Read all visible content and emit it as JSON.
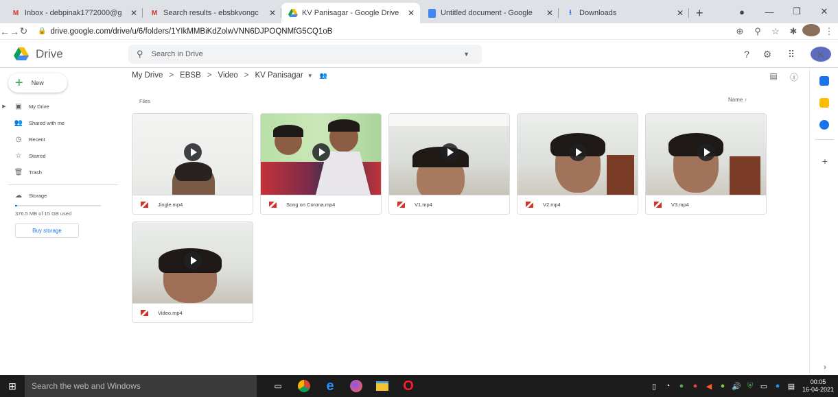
{
  "browser": {
    "tabs": [
      {
        "title": "Inbox - debpinak1772000@g",
        "icon": "gmail-icon",
        "active": false
      },
      {
        "title": "Search results - ebsbkvongc",
        "icon": "gmail-icon",
        "active": false
      },
      {
        "title": "KV Panisagar - Google Drive",
        "icon": "drive-icon",
        "active": true
      },
      {
        "title": "Untitled document - Google",
        "icon": "docs-icon",
        "active": false
      },
      {
        "title": "Downloads",
        "icon": "download-icon",
        "active": false
      }
    ],
    "url": "drive.google.com/drive/u/6/folders/1YIkMMBiKdZolwVNN6DJPOQNMfG5CQ1oB"
  },
  "drive": {
    "brand": "Drive",
    "search_placeholder": "Search in Drive",
    "account_initial": "K",
    "new_label": "New",
    "nav": [
      {
        "label": "My Drive",
        "icon": "my-drive-icon"
      },
      {
        "label": "Shared with me",
        "icon": "shared-icon"
      },
      {
        "label": "Recent",
        "icon": "clock-icon"
      },
      {
        "label": "Starred",
        "icon": "star-icon"
      },
      {
        "label": "Trash",
        "icon": "trash-icon"
      }
    ],
    "storage_label": "Storage",
    "storage_used": "376.5 MB of 15 GB used",
    "storage_fraction": 0.025,
    "buy_storage": "Buy storage",
    "breadcrumb": [
      "My Drive",
      "EBSB",
      "Video",
      "KV Panisagar"
    ],
    "section_label": "Files",
    "sort_label": "Name",
    "files": [
      {
        "name": "Jingle.mp4"
      },
      {
        "name": "Song on Corona.mp4"
      },
      {
        "name": "V1.mp4"
      },
      {
        "name": "V2.mp4"
      },
      {
        "name": "V3.mp4"
      },
      {
        "name": "Video.mp4"
      }
    ]
  },
  "taskbar": {
    "search_placeholder": "Search the web and Windows",
    "time": "00:05",
    "date": "16-04-2021"
  },
  "colors": {
    "accent": "#1a73e8",
    "video_red": "#d93025",
    "new_plus": "#34a853"
  }
}
